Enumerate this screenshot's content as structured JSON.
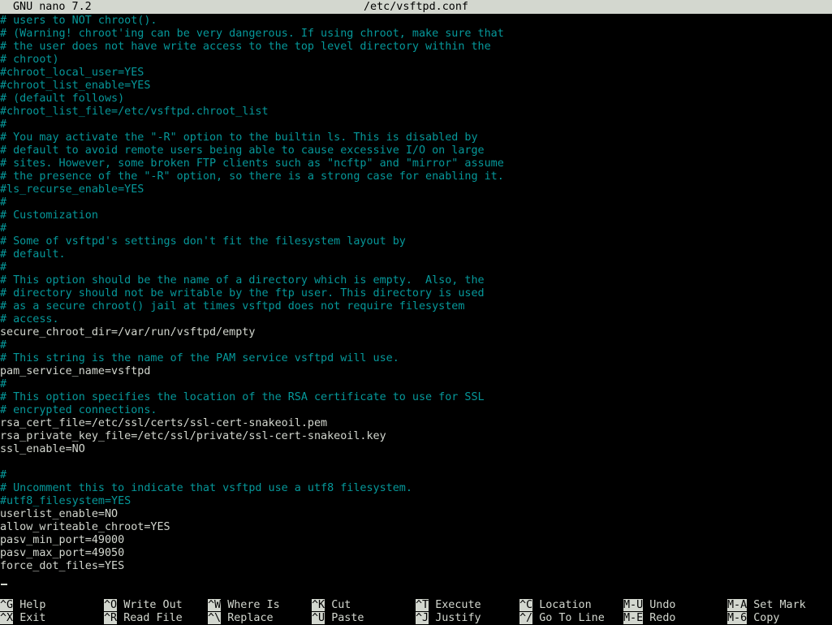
{
  "titlebar": {
    "version": "GNU nano 7.2",
    "filename": "/etc/vsftpd.conf"
  },
  "lines": [
    {
      "text": "# users to NOT chroot().",
      "type": "comment"
    },
    {
      "text": "# (Warning! chroot'ing can be very dangerous. If using chroot, make sure that",
      "type": "comment"
    },
    {
      "text": "# the user does not have write access to the top level directory within the",
      "type": "comment"
    },
    {
      "text": "# chroot)",
      "type": "comment"
    },
    {
      "text": "#chroot_local_user=YES",
      "type": "comment"
    },
    {
      "text": "#chroot_list_enable=YES",
      "type": "comment"
    },
    {
      "text": "# (default follows)",
      "type": "comment"
    },
    {
      "text": "#chroot_list_file=/etc/vsftpd.chroot_list",
      "type": "comment"
    },
    {
      "text": "#",
      "type": "comment"
    },
    {
      "text": "# You may activate the \"-R\" option to the builtin ls. This is disabled by",
      "type": "comment"
    },
    {
      "text": "# default to avoid remote users being able to cause excessive I/O on large",
      "type": "comment"
    },
    {
      "text": "# sites. However, some broken FTP clients such as \"ncftp\" and \"mirror\" assume",
      "type": "comment"
    },
    {
      "text": "# the presence of the \"-R\" option, so there is a strong case for enabling it.",
      "type": "comment"
    },
    {
      "text": "#ls_recurse_enable=YES",
      "type": "comment"
    },
    {
      "text": "#",
      "type": "comment"
    },
    {
      "text": "# Customization",
      "type": "comment"
    },
    {
      "text": "#",
      "type": "comment"
    },
    {
      "text": "# Some of vsftpd's settings don't fit the filesystem layout by",
      "type": "comment"
    },
    {
      "text": "# default.",
      "type": "comment"
    },
    {
      "text": "#",
      "type": "comment"
    },
    {
      "text": "# This option should be the name of a directory which is empty.  Also, the",
      "type": "comment"
    },
    {
      "text": "# directory should not be writable by the ftp user. This directory is used",
      "type": "comment"
    },
    {
      "text": "# as a secure chroot() jail at times vsftpd does not require filesystem",
      "type": "comment"
    },
    {
      "text": "# access.",
      "type": "comment"
    },
    {
      "text": "secure_chroot_dir=/var/run/vsftpd/empty",
      "type": "plain"
    },
    {
      "text": "#",
      "type": "comment"
    },
    {
      "text": "# This string is the name of the PAM service vsftpd will use.",
      "type": "comment"
    },
    {
      "text": "pam_service_name=vsftpd",
      "type": "plain"
    },
    {
      "text": "#",
      "type": "comment"
    },
    {
      "text": "# This option specifies the location of the RSA certificate to use for SSL",
      "type": "comment"
    },
    {
      "text": "# encrypted connections.",
      "type": "comment"
    },
    {
      "text": "rsa_cert_file=/etc/ssl/certs/ssl-cert-snakeoil.pem",
      "type": "plain"
    },
    {
      "text": "rsa_private_key_file=/etc/ssl/private/ssl-cert-snakeoil.key",
      "type": "plain"
    },
    {
      "text": "ssl_enable=NO",
      "type": "plain"
    },
    {
      "text": "",
      "type": "plain"
    },
    {
      "text": "#",
      "type": "comment"
    },
    {
      "text": "# Uncomment this to indicate that vsftpd use a utf8 filesystem.",
      "type": "comment"
    },
    {
      "text": "#utf8_filesystem=YES",
      "type": "comment"
    },
    {
      "text": "userlist_enable=NO",
      "type": "plain"
    },
    {
      "text": "allow_writeable_chroot=YES",
      "type": "plain"
    },
    {
      "text": "pasv_min_port=49000",
      "type": "plain"
    },
    {
      "text": "pasv_max_port=49050",
      "type": "plain"
    },
    {
      "text": "force_dot_files=YES",
      "type": "plain"
    }
  ],
  "shortcuts": [
    [
      {
        "key": "^G",
        "label": "Help"
      },
      {
        "key": "^O",
        "label": "Write Out"
      },
      {
        "key": "^W",
        "label": "Where Is"
      },
      {
        "key": "^K",
        "label": "Cut"
      },
      {
        "key": "^T",
        "label": "Execute"
      },
      {
        "key": "^C",
        "label": "Location"
      },
      {
        "key": "M-U",
        "label": "Undo"
      },
      {
        "key": "M-A",
        "label": "Set Mark"
      }
    ],
    [
      {
        "key": "^X",
        "label": "Exit"
      },
      {
        "key": "^R",
        "label": "Read File"
      },
      {
        "key": "^\\",
        "label": "Replace"
      },
      {
        "key": "^U",
        "label": "Paste"
      },
      {
        "key": "^J",
        "label": "Justify"
      },
      {
        "key": "^/",
        "label": "Go To Line"
      },
      {
        "key": "M-E",
        "label": "Redo"
      },
      {
        "key": "M-6",
        "label": "Copy"
      }
    ]
  ]
}
